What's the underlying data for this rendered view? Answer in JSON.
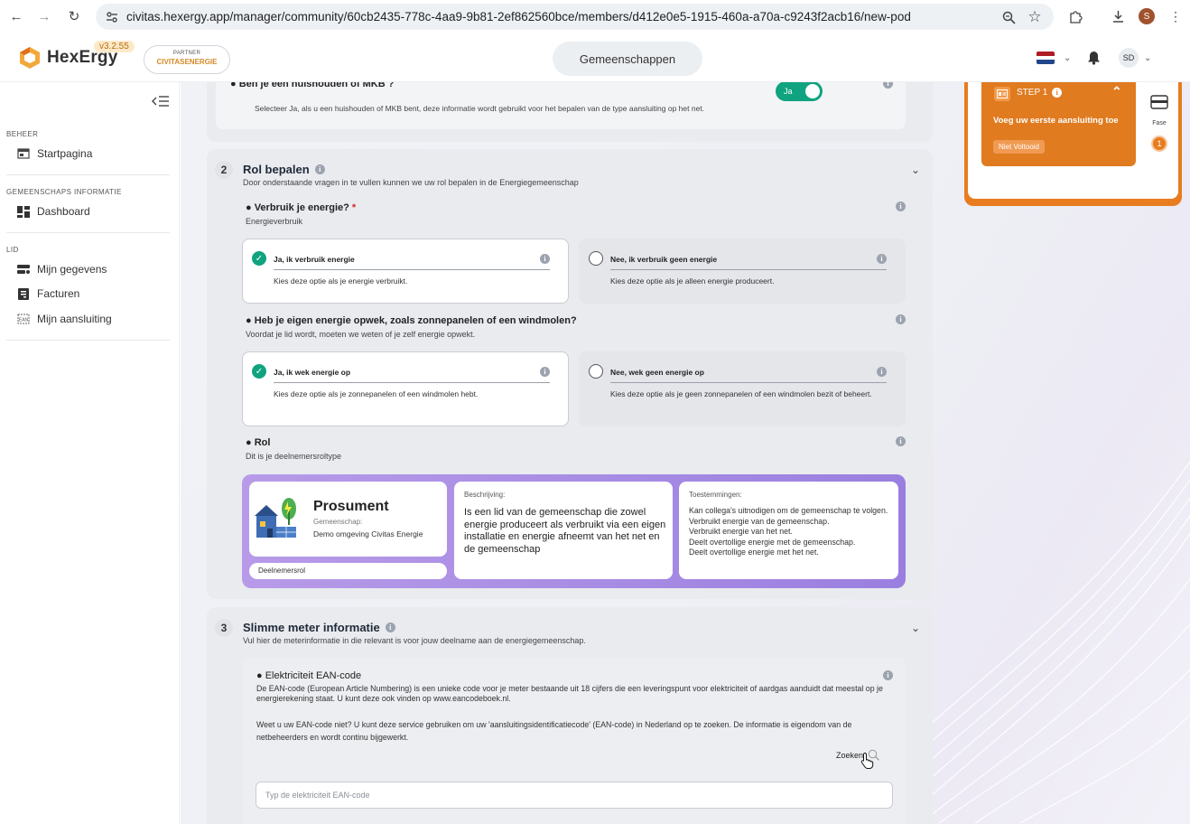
{
  "browser": {
    "url": "civitas.hexergy.app/manager/community/60cb2435-778c-4aa9-9b81-2ef862560bce/members/d412e0e5-1915-460a-a70a-c9243f2acb16/new-pod",
    "profile_initial": "S"
  },
  "header": {
    "app_name": "HexErgy",
    "version": "v3.2.55",
    "partner_label": "PARTNER",
    "partner_name": "CIVITASENERGIE",
    "center_button": "Gemeenschappen",
    "user_initials": "SD"
  },
  "sidebar": {
    "sections": [
      {
        "title": "BEHEER",
        "items": [
          {
            "label": "Startpagina",
            "icon": "home-page-icon"
          }
        ]
      },
      {
        "title": "GEMEENSCHAPS INFORMATIE",
        "items": [
          {
            "label": "Dashboard",
            "icon": "dashboard-icon"
          }
        ]
      },
      {
        "title": "LID",
        "items": [
          {
            "label": "Mijn gegevens",
            "icon": "user-data-icon"
          },
          {
            "label": "Facturen",
            "icon": "invoice-icon"
          },
          {
            "label": "Mijn aansluiting",
            "icon": "connection-icon"
          }
        ]
      }
    ]
  },
  "section1": {
    "question": "Ben je een huishouden of MKB ?",
    "desc": "Selecteer Ja, als u een huishouden of MKB bent, deze informatie wordt gebruikt voor het bepalen van de type aansluiting op het net.",
    "toggle_label": "Ja"
  },
  "section2": {
    "number": "2",
    "title": "Rol bepalen",
    "subtitle": "Door onderstaande vragen in te vullen kunnen we uw rol bepalen in de Energiegemeenschap",
    "q1": {
      "title": "Verbruik je energie?",
      "required": "*",
      "sub": "Energieverbruik",
      "options": [
        {
          "title": "Ja, ik verbruik energie",
          "desc": "Kies deze optie als je energie verbruikt.",
          "selected": true
        },
        {
          "title": "Nee, ik verbruik geen energie",
          "desc": "Kies deze optie als je alleen energie produceert.",
          "selected": false
        }
      ]
    },
    "q2": {
      "title": "Heb je eigen energie opwek, zoals zonnepanelen of een windmolen?",
      "sub": "Voordat je lid wordt, moeten we weten of je zelf energie opwekt.",
      "options": [
        {
          "title": "Ja, ik wek energie op",
          "desc": "Kies deze optie als je zonnepanelen of een windmolen hebt.",
          "selected": true
        },
        {
          "title": "Nee, wek geen energie op",
          "desc": "Kies deze optie als je geen zonnepanelen of een windmolen bezit of beheert.",
          "selected": false
        }
      ]
    },
    "q3": {
      "title": "Rol",
      "sub": "Dit is je deelnemersroltype"
    },
    "role": {
      "name": "Prosument",
      "community_label": "Gemeenschap:",
      "community": "Demo omgeving Civitas Energie",
      "badge": "Deelnemersrol",
      "desc_label": "Beschrijving:",
      "desc": "Is een lid van de gemeenschap die zowel energie produceert als verbruikt via een eigen installatie en energie afneemt van het net en de gemeenschap",
      "perm_label": "Toestemmingen:",
      "permissions": [
        "Kan collega's uitnodigen om de gemeenschap te volgen.",
        "Verbruikt energie van de gemeenschap.",
        "Verbruikt energie van het net.",
        "Deelt overtollige energie met de gemeenschap.",
        "Deelt overtollige energie met het net."
      ]
    }
  },
  "section3": {
    "number": "3",
    "title": "Slimme meter informatie",
    "subtitle": "Vul hier de meterinformatie in die relevant is voor jouw deelname aan de energiegemeenschap.",
    "ean_title": "Elektriciteit EAN-code",
    "ean_desc1": "De EAN-code (European Article Numbering) is een unieke code voor je meter bestaande uit 18 cijfers die een leveringspunt voor elektriciteit of aardgas aanduidt dat meestal op je energierekening staat. U kunt deze ook vinden op www.eancodeboek.nl.",
    "ean_desc2": "Weet u uw EAN-code niet? U kunt deze service gebruiken om uw 'aansluitingsidentificatiecode' (EAN-code) in Nederland op te zoeken. De informatie is eigendom van de netbeheerders en wordt continu bijgewerkt.",
    "search_label": "Zoeken",
    "input_placeholder": "Typ de elektriciteit EAN-code"
  },
  "steps_panel": {
    "step_label": "STEP 1",
    "step_title": "Voeg uw eerste aansluiting toe",
    "status": "Niet Voltooid",
    "fase_label": "Fase",
    "fase_number": "1"
  },
  "colors": {
    "accent_green": "#10a37f",
    "brand_orange": "#e87c1f",
    "role_purple": "#9a7fe0"
  }
}
